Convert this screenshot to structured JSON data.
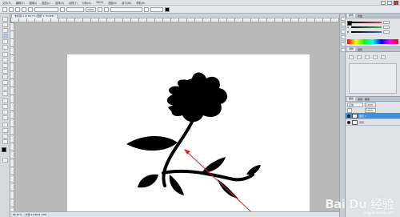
{
  "app": {
    "menu": [
      "文件(F)",
      "编辑(E)",
      "图像(I)",
      "图层(L)",
      "选择(S)",
      "滤镜(T)",
      "分析(A)",
      "3D(D)",
      "视图(V)",
      "窗口(W)",
      "帮助(H)"
    ]
  },
  "options_bar": {
    "zoom": "100%"
  },
  "document": {
    "tab_label": "未标题-1 @ 66.7% (图层 1, RGB/8)"
  },
  "status": {
    "zoom": "66.67%",
    "doc_size": "文档:1.03M/1.37M"
  },
  "panels": {
    "color_tab": "颜色",
    "swatches_tab": "色板",
    "adjust_tab": "调整",
    "styles_tab": "蒙版",
    "layers_tab": "图层",
    "channels_tab": "通道",
    "paths_tab": "路径",
    "blend_mode": "正常",
    "opacity": "100%",
    "fill": "100%",
    "layers": [
      {
        "name": "图层 1",
        "selected": true
      },
      {
        "name": "背景",
        "selected": false
      }
    ],
    "rgb": [
      {
        "channel": "R",
        "color": "#e04040"
      },
      {
        "channel": "G",
        "color": "#40b040"
      },
      {
        "channel": "B",
        "color": "#4060e0"
      }
    ]
  },
  "watermark": {
    "logo": "Bai Du 经验",
    "url": "jingyan.baidu.com"
  },
  "colors": {
    "silhouette": "#000000",
    "arrow": "#e02020",
    "selection": "#3d8ee5"
  }
}
